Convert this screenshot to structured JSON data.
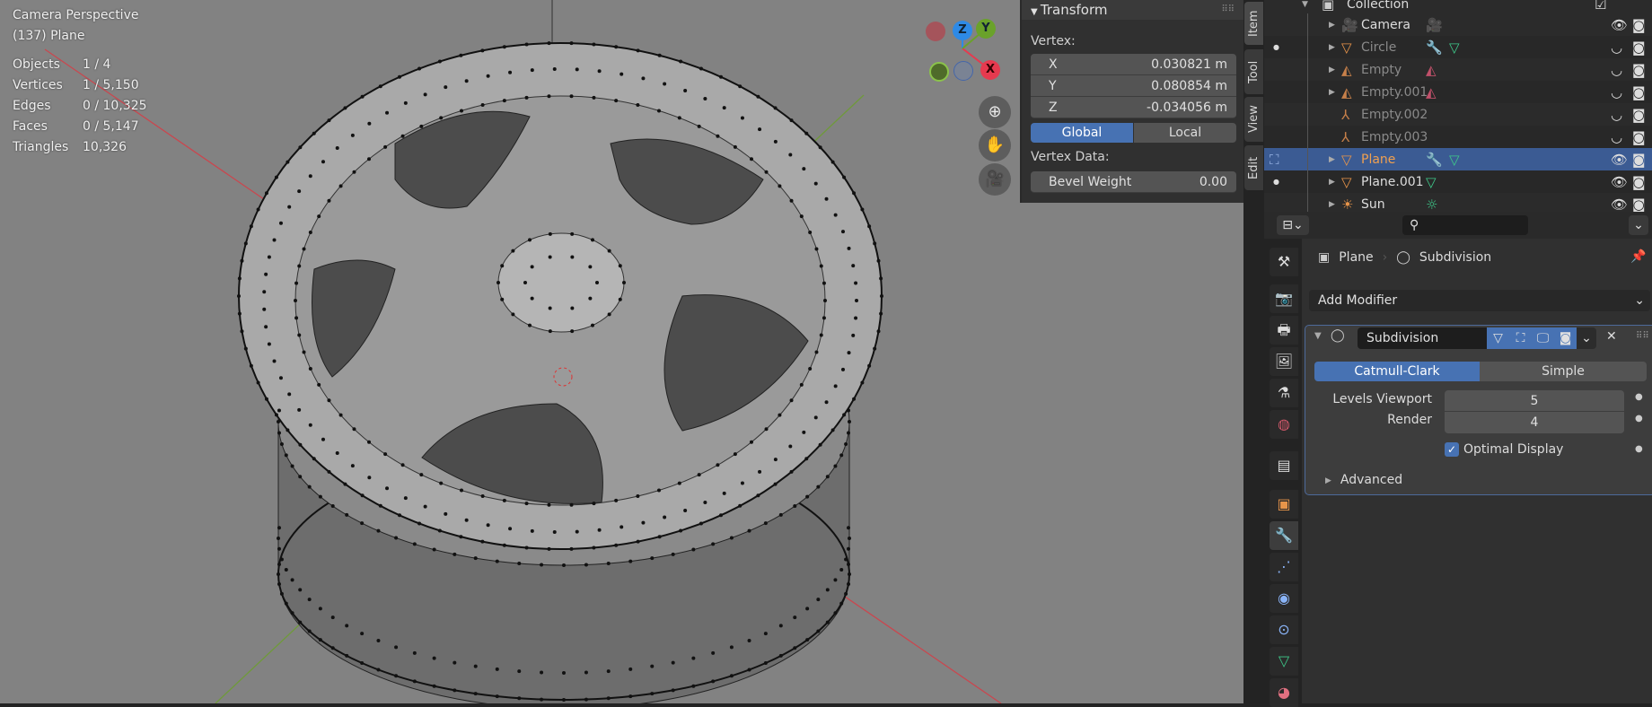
{
  "viewport": {
    "view_name": "Camera Perspective",
    "object_label": "(137) Plane",
    "stats": [
      {
        "label": "Objects",
        "value": "1 / 4"
      },
      {
        "label": "Vertices",
        "value": "1 / 5,150"
      },
      {
        "label": "Edges",
        "value": "0 / 10,325"
      },
      {
        "label": "Faces",
        "value": "0 / 5,147"
      },
      {
        "label": "Triangles",
        "value": "10,326"
      }
    ],
    "gizmo": {
      "z": "Z",
      "y": "Y",
      "x": "X",
      "colors": {
        "x": "#e63a4f",
        "y": "#6aa22a",
        "z": "#2e8ae6"
      }
    },
    "nav_icons": [
      "zoom-icon",
      "hand-pan-icon",
      "camera-view-icon"
    ]
  },
  "sidebar": {
    "panel_title": "Transform",
    "vertex_label": "Vertex:",
    "x_label": "X",
    "x_value": "0.030821 m",
    "y_label": "Y",
    "y_value": "0.080854 m",
    "z_label": "Z",
    "z_value": "-0.034056 m",
    "global_label": "Global",
    "local_label": "Local",
    "vertex_data_label": "Vertex Data:",
    "bevel_label": "Bevel Weight",
    "bevel_value": "0.00",
    "tabs": [
      "Item",
      "Tool",
      "View",
      "Edit"
    ],
    "active_tab": "Item"
  },
  "outliner": {
    "collection": "Collection",
    "items": [
      {
        "name": "Camera"
      },
      {
        "name": "Circle"
      },
      {
        "name": "Empty"
      },
      {
        "name": "Empty.001"
      },
      {
        "name": "Empty.002"
      },
      {
        "name": "Empty.003"
      },
      {
        "name": "Plane"
      },
      {
        "name": "Plane.001"
      },
      {
        "name": "Sun"
      }
    ],
    "selected": "Plane"
  },
  "properties": {
    "breadcrumb_object": "Plane",
    "breadcrumb_modifier": "Subdivision",
    "add_modifier": "Add Modifier",
    "modifier": {
      "name": "Subdivision",
      "catmull_clark": "Catmull-Clark",
      "simple": "Simple",
      "levels_viewport_label": "Levels Viewport",
      "levels_viewport": "5",
      "render_label": "Render",
      "render": "4",
      "optimal_display_label": "Optimal Display",
      "optimal_display": true,
      "advanced_label": "Advanced"
    },
    "accent": "#4772b3"
  }
}
